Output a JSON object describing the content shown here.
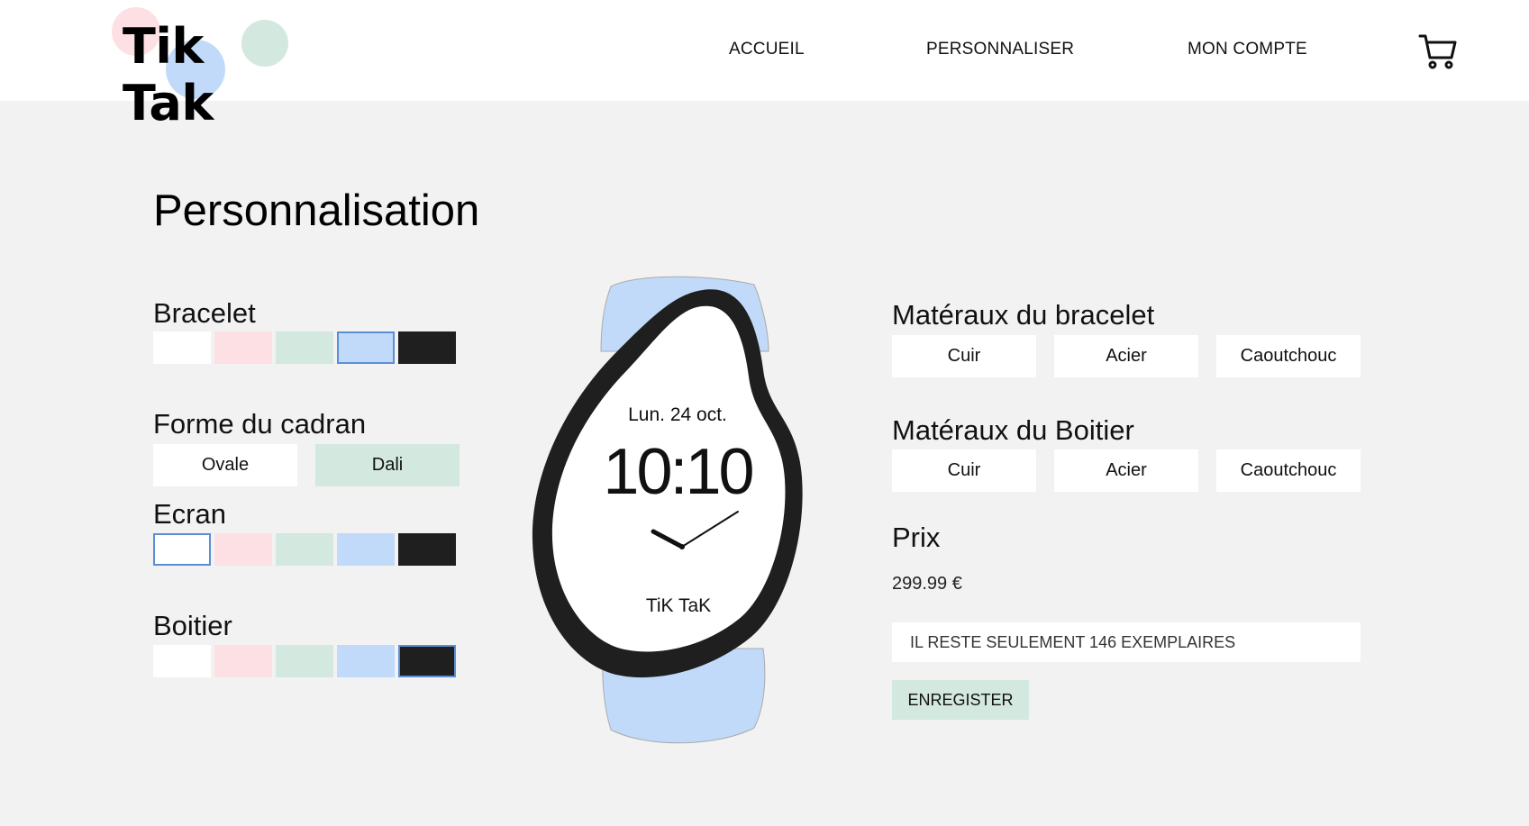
{
  "header": {
    "logo_text": "Tik Tak",
    "nav": {
      "home": "ACCUEIL",
      "customize": "PERSONNALISER",
      "account": "MON COMPTE"
    },
    "cart_icon": "cart-icon"
  },
  "page_title": "Personnalisation",
  "options": {
    "bracelet": {
      "label": "Bracelet",
      "selected": "blue"
    },
    "dial_shape": {
      "label": "Forme du cadran",
      "choices": [
        "Ovale",
        "Dali"
      ],
      "selected": "Dali"
    },
    "screen": {
      "label": "Ecran",
      "selected": "white"
    },
    "case": {
      "label": "Boitier",
      "selected": "black"
    }
  },
  "colors": {
    "white": "#ffffff",
    "pink": "#fde0e3",
    "green": "#d3e8df",
    "blue": "#c2daf9",
    "black": "#1f1f1f",
    "selected_border": "#5a8fd6"
  },
  "watch": {
    "date": "Lun. 24 oct.",
    "time": "10:10",
    "brand": "TiK TaK"
  },
  "materials": {
    "bracelet": {
      "label": "Matéraux du bracelet",
      "choices": [
        "Cuir",
        "Acier",
        "Caoutchouc"
      ]
    },
    "case": {
      "label": "Matéraux du Boitier",
      "choices": [
        "Cuir",
        "Acier",
        "Caoutchouc"
      ]
    }
  },
  "price": {
    "label": "Prix",
    "value": "299.99 €"
  },
  "stock_notice": "IL RESTE SEULEMENT 146 EXEMPLAIRES",
  "save_label": "ENREGISTER"
}
